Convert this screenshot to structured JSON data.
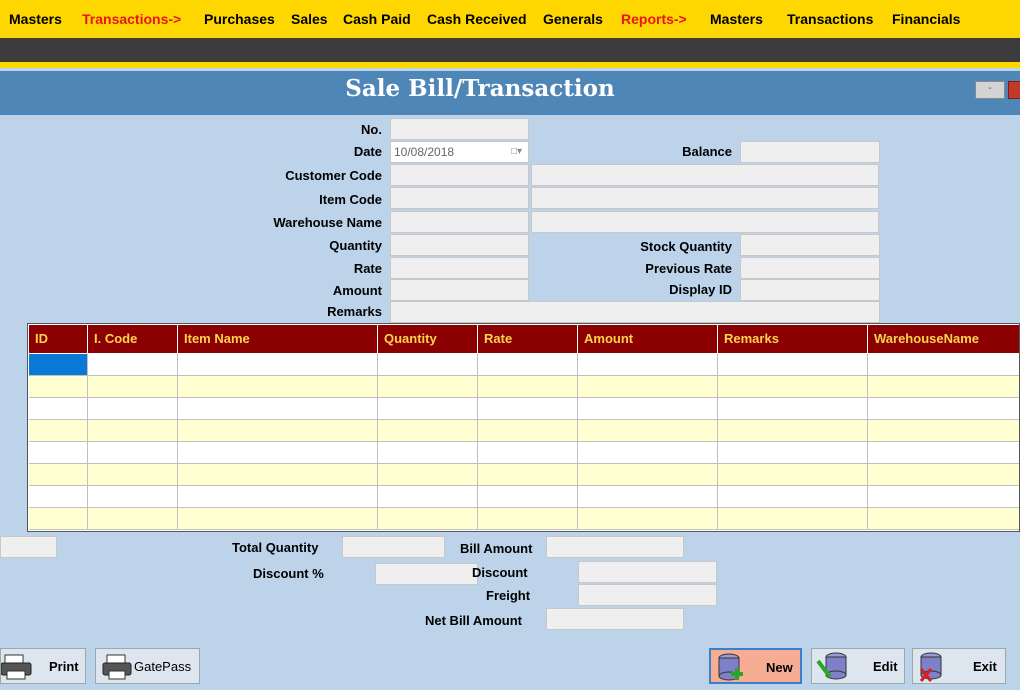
{
  "menu": [
    {
      "label": "Masters",
      "red": false
    },
    {
      "label": "Transactions->",
      "red": true
    },
    {
      "label": "Purchases",
      "red": false
    },
    {
      "label": "Sales",
      "red": false
    },
    {
      "label": "Cash Paid",
      "red": false
    },
    {
      "label": "Cash Received",
      "red": false
    },
    {
      "label": "Generals",
      "red": false
    },
    {
      "label": "Reports->",
      "red": true
    },
    {
      "label": "Masters",
      "red": false
    },
    {
      "label": "Transactions",
      "red": false
    },
    {
      "label": "Financials",
      "red": false
    }
  ],
  "window": {
    "title": "Sale Bill/Transaction",
    "min_label": "-"
  },
  "form": {
    "no_label": "No.",
    "date_label": "Date",
    "date_value": "10/08/2018",
    "balance_label": "Balance",
    "customer_code_label": "Customer Code",
    "item_code_label": "Item Code",
    "warehouse_name_label": "Warehouse Name",
    "quantity_label": "Quantity",
    "stock_quantity_label": "Stock Quantity",
    "rate_label": "Rate",
    "previous_rate_label": "Previous Rate",
    "amount_label": "Amount",
    "display_id_label": "Display ID",
    "remarks_label": "Remarks"
  },
  "grid": {
    "columns": [
      "ID",
      "I. Code",
      "Item Name",
      "Quantity",
      "Rate",
      "Amount",
      "Remarks",
      "WarehouseName"
    ],
    "row_count": 8
  },
  "totals": {
    "total_quantity_label": "Total Quantity",
    "bill_amount_label": "Bill Amount",
    "discount_pct_label": "Discount %",
    "discount_label": "Discount",
    "freight_label": "Freight",
    "net_bill_amount_label": "Net Bill Amount"
  },
  "buttons": {
    "print": "Print",
    "gatepass": "GatePass",
    "new": "New",
    "edit": "Edit",
    "exit": "Exit"
  },
  "colors": {
    "menu_bg": "#ffd700",
    "menu_highlight": "#e8161b",
    "title_bar": "#4f86b8",
    "form_bg": "#bcd3ea",
    "grid_header": "#8b0000",
    "grid_header_text": "#ffd34d",
    "grid_alt_row": "#ffffd2",
    "new_button": "#f7ad94"
  }
}
